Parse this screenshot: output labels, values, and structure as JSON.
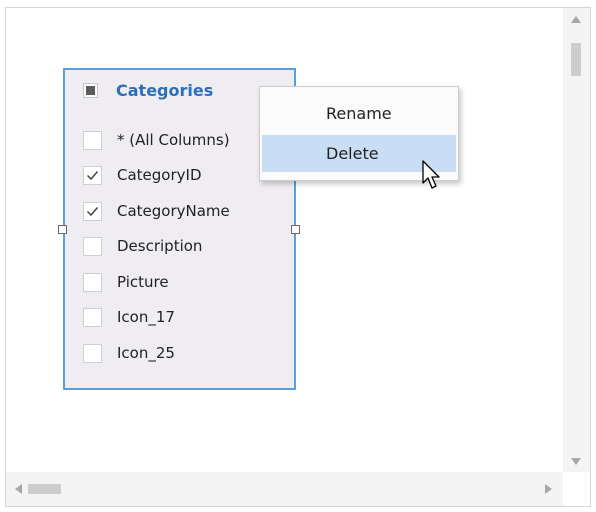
{
  "table": {
    "title": "Categories",
    "columns": [
      {
        "label": "* (All Columns)",
        "checked": false
      },
      {
        "label": "CategoryID",
        "checked": true
      },
      {
        "label": "CategoryName",
        "checked": true
      },
      {
        "label": "Description",
        "checked": false
      },
      {
        "label": "Picture",
        "checked": false
      },
      {
        "label": "Icon_17",
        "checked": false
      },
      {
        "label": "Icon_25",
        "checked": false
      }
    ]
  },
  "context_menu": {
    "items": [
      {
        "label": "Rename",
        "highlighted": false
      },
      {
        "label": "Delete",
        "highlighted": true
      }
    ]
  },
  "colors": {
    "table_border": "#5a9fd8",
    "table_title": "#2d6fb8",
    "menu_highlight": "#c9def4"
  }
}
